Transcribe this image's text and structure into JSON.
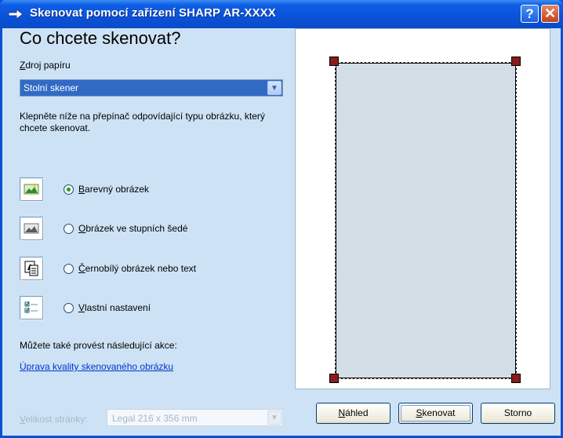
{
  "titlebar": {
    "title": "Skenovat pomocí zařízení SHARP AR-XXXX",
    "help": "?",
    "close": "✕"
  },
  "heading": "Co chcete skenovat?",
  "paper_source": {
    "label": "Zdroj papíru",
    "value": "Stolní skener"
  },
  "instruction": "Klepněte níže na přepínač odpovídající typu obrázku, který chcete skenovat.",
  "options": [
    {
      "label": "Barevný obrázek",
      "selected": true,
      "icon": "color-picture-icon"
    },
    {
      "label": "Obrázek ve stupních šedé",
      "selected": false,
      "icon": "grayscale-picture-icon"
    },
    {
      "label": "Černobílý obrázek nebo text",
      "selected": false,
      "icon": "black-white-text-icon"
    },
    {
      "label": "Vlastní nastavení",
      "selected": false,
      "icon": "custom-settings-icon"
    }
  ],
  "also_text": "Můžete také provést následující akce:",
  "quality_link": "Úprava kvality skenovaného obrázku",
  "page_size": {
    "label": "Velikost stránky:",
    "value": "Legal 216 x 356 mm"
  },
  "buttons": {
    "preview": "Náhled",
    "scan": "Skenovat",
    "cancel": "Storno"
  },
  "colors": {
    "titlebar": "#0a52d8",
    "client": "#cde3f5",
    "selection": "#316ac5",
    "preview_page": "#d3dee6",
    "handle": "#8a1c1c"
  }
}
